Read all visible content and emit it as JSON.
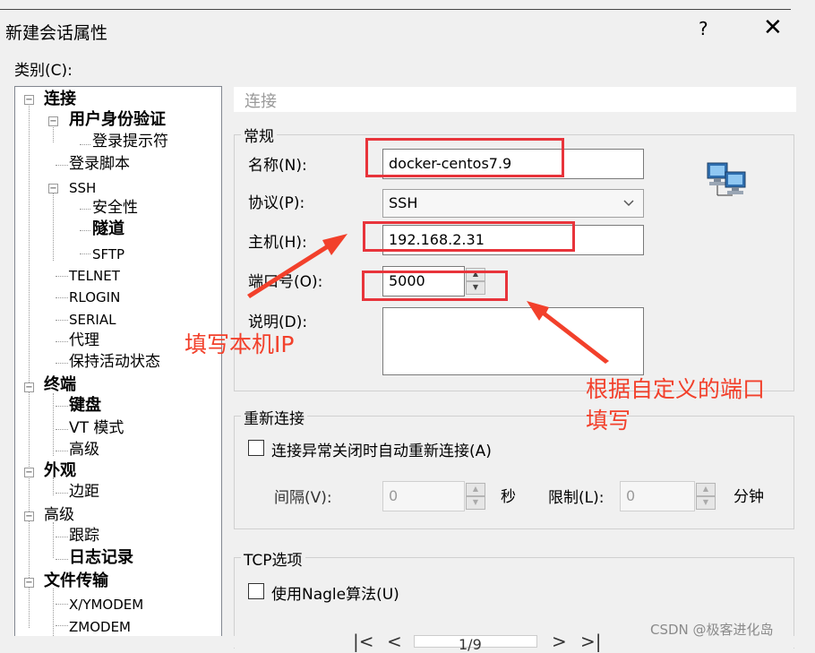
{
  "window": {
    "title": "新建会话属性",
    "help_label": "?",
    "close_label": "✕"
  },
  "category_label": "类别(C):",
  "tree": {
    "items": [
      {
        "label": "连接",
        "bold": true
      },
      {
        "label": "用户身份验证",
        "bold": true
      },
      {
        "label": "登录提示符"
      },
      {
        "label": "登录脚本"
      },
      {
        "label": "SSH"
      },
      {
        "label": "安全性"
      },
      {
        "label": "隧道",
        "bold": true
      },
      {
        "label": "SFTP"
      },
      {
        "label": "TELNET"
      },
      {
        "label": "RLOGIN"
      },
      {
        "label": "SERIAL"
      },
      {
        "label": "代理"
      },
      {
        "label": "保持活动状态"
      },
      {
        "label": "终端",
        "bold": true
      },
      {
        "label": "键盘",
        "bold": true
      },
      {
        "label": "VT 模式"
      },
      {
        "label": "高级"
      },
      {
        "label": "外观",
        "bold": true
      },
      {
        "label": "边距"
      },
      {
        "label": "高级"
      },
      {
        "label": "跟踪"
      },
      {
        "label": "日志记录",
        "bold": true
      },
      {
        "label": "文件传输",
        "bold": true
      },
      {
        "label": "X/YMODEM"
      },
      {
        "label": "ZMODEM"
      }
    ]
  },
  "section_header": "连接",
  "general": {
    "group_label": "常规",
    "name_label": "名称(N):",
    "name_value": "docker-centos7.9",
    "protocol_label": "协议(P):",
    "protocol_value": "SSH",
    "host_label": "主机(H):",
    "host_value": "192.168.2.31",
    "port_label": "端口号(O):",
    "port_value": "5000",
    "desc_label": "说明(D):",
    "desc_value": ""
  },
  "reconnect": {
    "group_label": "重新连接",
    "checkbox_label": "连接异常关闭时自动重新连接(A)",
    "interval_label": "间隔(V):",
    "interval_value": "0",
    "interval_unit": "秒",
    "limit_label": "限制(L):",
    "limit_value": "0",
    "limit_unit": "分钟"
  },
  "tcp": {
    "group_label": "TCP选项",
    "nagle_label": "使用Nagle算法(U)"
  },
  "annotations": {
    "host_note": "填写本机IP",
    "port_note_line1": "根据自定义的端口",
    "port_note_line2": "填写",
    "color": "#f2402b"
  },
  "pager": {
    "first": "|<",
    "prev": "<",
    "page": "1/9",
    "next": ">",
    "last": ">|"
  },
  "watermark": "CSDN @极客进化岛",
  "icons": [
    "computers-network-icon",
    "chevron-down-icon",
    "close-icon",
    "spin-up-icon",
    "spin-down-icon"
  ]
}
